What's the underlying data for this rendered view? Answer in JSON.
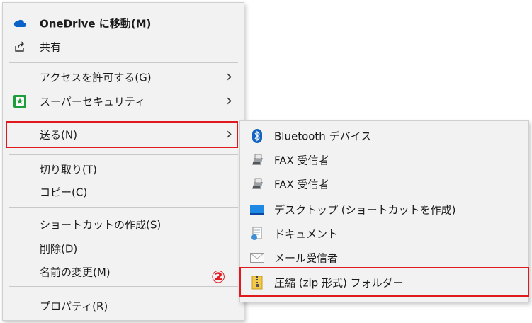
{
  "main_menu": {
    "onedrive": "OneDrive に移動(M)",
    "share": "共有",
    "access": "アクセスを許可する(G)",
    "security": "スーパーセキュリティ",
    "send_to": "送る(N)",
    "cut": "切り取り(T)",
    "copy": "コピー(C)",
    "shortcut": "ショートカットの作成(S)",
    "delete": "削除(D)",
    "rename": "名前の変更(M)",
    "properties": "プロパティ(R)"
  },
  "sub_menu": {
    "bluetooth": "Bluetooth デバイス",
    "fax1": "FAX 受信者",
    "fax2": "FAX 受信者",
    "desktop": "デスクトップ (ショートカットを作成)",
    "documents": "ドキュメント",
    "mail": "メール受信者",
    "zip": "圧縮 (zip 形式) フォルダー"
  },
  "annotation": {
    "step": "②"
  },
  "colors": {
    "highlight": "#e0191f",
    "menu_bg": "#f2f2f2",
    "onedrive": "#0a64c8"
  }
}
